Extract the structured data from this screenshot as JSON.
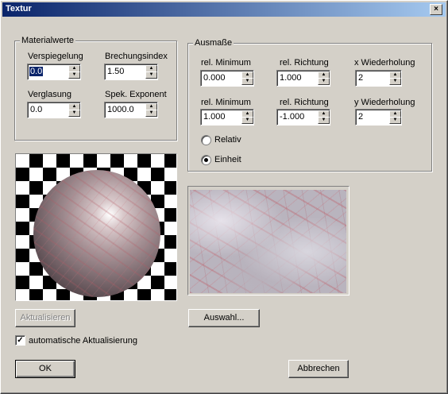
{
  "window": {
    "title": "Textur",
    "close_glyph": "×"
  },
  "material": {
    "group_label": "Materialwerte",
    "verspiegelung": {
      "label": "Verspiegelung",
      "value": "0.0"
    },
    "brechungsindex": {
      "label": "Brechungsindex",
      "value": "1.50"
    },
    "verglasung": {
      "label": "Verglasung",
      "value": "0.0"
    },
    "spek_exponent": {
      "label": "Spek. Exponent",
      "value": "1000.0"
    }
  },
  "ausmasse": {
    "group_label": "Ausmaße",
    "row1": {
      "min_label": "rel. Minimum",
      "min_value": "0.000",
      "dir_label": "rel. Richtung",
      "dir_value": "1.000",
      "rep_label": "x Wiederholung",
      "rep_value": "2"
    },
    "row2": {
      "min_label": "rel. Minimum",
      "min_value": "1.000",
      "dir_label": "rel. Richtung",
      "dir_value": "-1.000",
      "rep_label": "y Wiederholung",
      "rep_value": "2"
    },
    "radio_relativ": {
      "label": "Relativ",
      "checked": false
    },
    "radio_einheit": {
      "label": "Einheit",
      "checked": true
    }
  },
  "buttons": {
    "aktualisieren": "Aktualisieren",
    "auswahl": "Auswahl...",
    "ok": "OK",
    "abbrechen": "Abbrechen"
  },
  "auto_update": {
    "label": "automatische Aktualisierung",
    "checked": true
  },
  "icons": {
    "spin_up": "▲",
    "spin_down": "▼",
    "check": "✓"
  }
}
